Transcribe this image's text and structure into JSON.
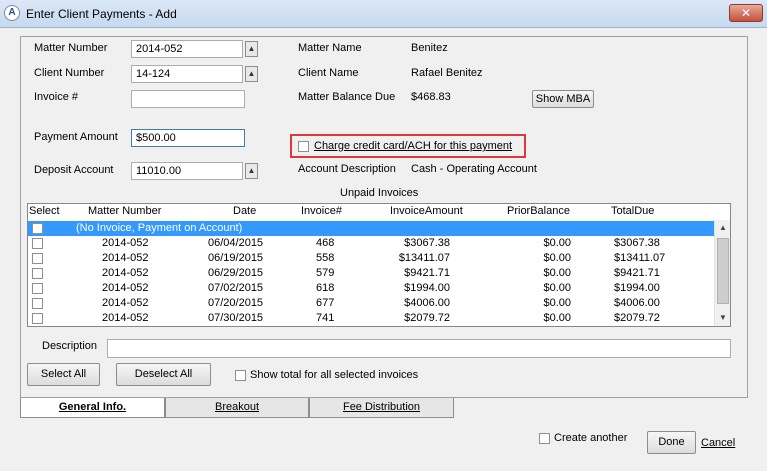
{
  "window": {
    "title": "Enter Client Payments - Add",
    "close_glyph": "✕"
  },
  "form": {
    "matter_number": {
      "label": "Matter Number",
      "value": "2014-052"
    },
    "client_number": {
      "label": "Client Number",
      "value": "14-124"
    },
    "invoice_number": {
      "label": "Invoice #",
      "value": ""
    },
    "payment_amount": {
      "label": "Payment Amount",
      "value": "$500.00"
    },
    "deposit_account": {
      "label": "Deposit Account",
      "value": "11010.00"
    },
    "matter_name": {
      "label": "Matter Name",
      "value": "Benitez"
    },
    "client_name": {
      "label": "Client Name",
      "value": "Rafael Benitez"
    },
    "matter_balance_due": {
      "label": "Matter Balance Due",
      "value": "$468.83"
    },
    "show_mba_button": "Show MBA",
    "charge_cc_label": "Charge credit card/ACH for this payment",
    "account_description": {
      "label": "Account Description",
      "value": "Cash - Operating Account"
    }
  },
  "invoices": {
    "section_title": "Unpaid Invoices",
    "columns": [
      "Select",
      "Matter Number",
      "Date",
      "Invoice#",
      "InvoiceAmount",
      "PriorBalance",
      "TotalDue"
    ],
    "no_invoice_row": "(No Invoice, Payment on Account)",
    "rows": [
      {
        "matter": "2014-052",
        "date": "06/04/2015",
        "invoice": "468",
        "amount": "$3067.38",
        "prior": "$0.00",
        "total": "$3067.38"
      },
      {
        "matter": "2014-052",
        "date": "06/19/2015",
        "invoice": "558",
        "amount": "$13411.07",
        "prior": "$0.00",
        "total": "$13411.07"
      },
      {
        "matter": "2014-052",
        "date": "06/29/2015",
        "invoice": "579",
        "amount": "$9421.71",
        "prior": "$0.00",
        "total": "$9421.71"
      },
      {
        "matter": "2014-052",
        "date": "07/02/2015",
        "invoice": "618",
        "amount": "$1994.00",
        "prior": "$0.00",
        "total": "$1994.00"
      },
      {
        "matter": "2014-052",
        "date": "07/20/2015",
        "invoice": "677",
        "amount": "$4006.00",
        "prior": "$0.00",
        "total": "$4006.00"
      },
      {
        "matter": "2014-052",
        "date": "07/30/2015",
        "invoice": "741",
        "amount": "$2079.72",
        "prior": "$0.00",
        "total": "$2079.72"
      }
    ]
  },
  "description": {
    "label": "Description",
    "value": ""
  },
  "buttons": {
    "select_all": "Select All",
    "deselect_all": "Deselect All",
    "show_total_label": "Show total for all selected invoices",
    "create_another_label": "Create another",
    "done": "Done",
    "cancel": "Cancel"
  },
  "tabs": [
    {
      "label": "General Info.",
      "active": true
    },
    {
      "label": "Breakout",
      "active": false
    },
    {
      "label": "Fee Distribution",
      "active": false
    }
  ],
  "colors": {
    "highlight_border": "#e0383a",
    "selected_row": "#3399ff"
  }
}
